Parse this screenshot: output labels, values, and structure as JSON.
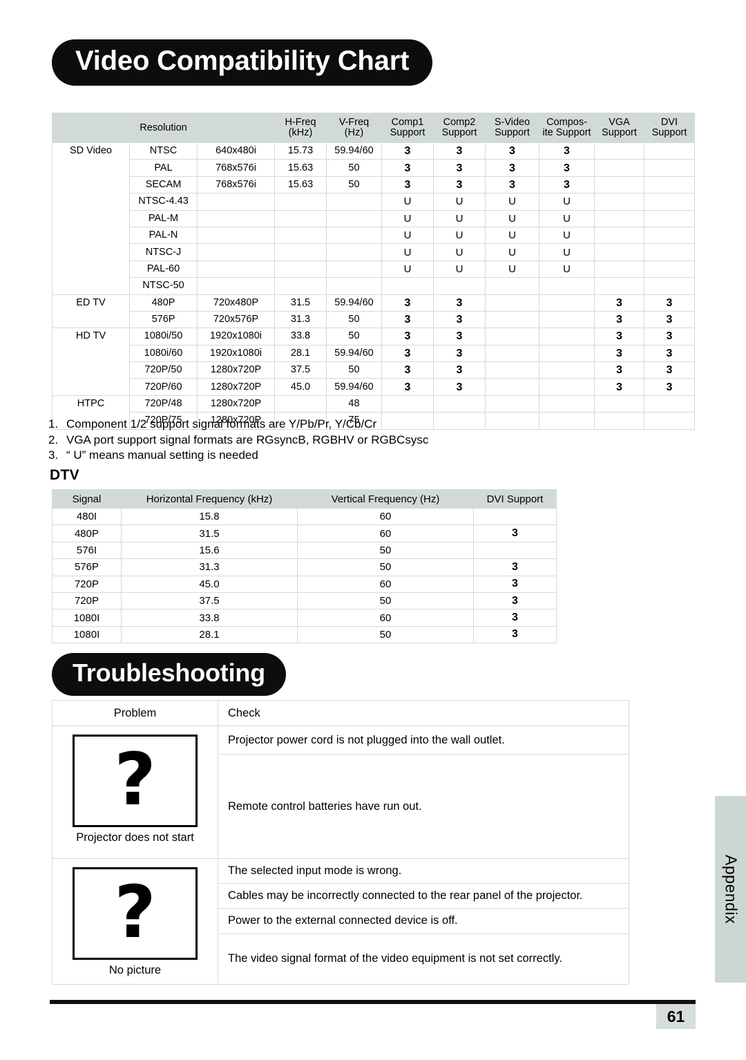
{
  "sections": {
    "video_title": "Video Compatibility Chart",
    "troubleshooting_title": "Troubleshooting",
    "dtv_heading": "DTV"
  },
  "video_chart": {
    "headers": {
      "resolution": "Resolution",
      "hfreq_l1": "H-Freq",
      "hfreq_l2": "(kHz)",
      "vfreq_l1": "V-Freq",
      "vfreq_l2": "(Hz)",
      "comp1_l1": "Comp1",
      "comp1_l2": "Support",
      "comp2_l1": "Comp2",
      "comp2_l2": "Support",
      "svideo_l1": "S-Video",
      "svideo_l2": "Support",
      "composite_l1": "Compos-",
      "composite_l2": "ite Support",
      "vga_l1": "VGA",
      "vga_l2": "Support",
      "dvi_l1": "DVI",
      "dvi_l2": "Support"
    },
    "categories": [
      {
        "name": "SD Video",
        "rows": [
          {
            "signal": "NTSC",
            "resolution": "640x480i",
            "hfreq": "15.73",
            "vfreq": "59.94/60",
            "comp1": "3",
            "comp2": "3",
            "svideo": "3",
            "composite": "3",
            "vga": "",
            "dvi": ""
          },
          {
            "signal": "PAL",
            "resolution": "768x576i",
            "hfreq": "15.63",
            "vfreq": "50",
            "comp1": "3",
            "comp2": "3",
            "svideo": "3",
            "composite": "3",
            "vga": "",
            "dvi": ""
          },
          {
            "signal": "SECAM",
            "resolution": "768x576i",
            "hfreq": "15.63",
            "vfreq": "50",
            "comp1": "3",
            "comp2": "3",
            "svideo": "3",
            "composite": "3",
            "vga": "",
            "dvi": ""
          },
          {
            "signal": "NTSC-4.43",
            "resolution": "",
            "hfreq": "",
            "vfreq": "",
            "comp1": "U",
            "comp2": "U",
            "svideo": "U",
            "composite": "U",
            "vga": "",
            "dvi": ""
          },
          {
            "signal": "PAL-M",
            "resolution": "",
            "hfreq": "",
            "vfreq": "",
            "comp1": "U",
            "comp2": "U",
            "svideo": "U",
            "composite": "U",
            "vga": "",
            "dvi": ""
          },
          {
            "signal": "PAL-N",
            "resolution": "",
            "hfreq": "",
            "vfreq": "",
            "comp1": "U",
            "comp2": "U",
            "svideo": "U",
            "composite": "U",
            "vga": "",
            "dvi": ""
          },
          {
            "signal": "NTSC-J",
            "resolution": "",
            "hfreq": "",
            "vfreq": "",
            "comp1": "U",
            "comp2": "U",
            "svideo": "U",
            "composite": "U",
            "vga": "",
            "dvi": ""
          },
          {
            "signal": "PAL-60",
            "resolution": "",
            "hfreq": "",
            "vfreq": "",
            "comp1": "U",
            "comp2": "U",
            "svideo": "U",
            "composite": "U",
            "vga": "",
            "dvi": ""
          },
          {
            "signal": "NTSC-50",
            "resolution": "",
            "hfreq": "",
            "vfreq": "",
            "comp1": "",
            "comp2": "",
            "svideo": "",
            "composite": "",
            "vga": "",
            "dvi": ""
          }
        ]
      },
      {
        "name": "ED TV",
        "rows": [
          {
            "signal": "480P",
            "resolution": "720x480P",
            "hfreq": "31.5",
            "vfreq": "59.94/60",
            "comp1": "3",
            "comp2": "3",
            "svideo": "",
            "composite": "",
            "vga": "3",
            "dvi": "3"
          },
          {
            "signal": "576P",
            "resolution": "720x576P",
            "hfreq": "31.3",
            "vfreq": "50",
            "comp1": "3",
            "comp2": "3",
            "svideo": "",
            "composite": "",
            "vga": "3",
            "dvi": "3"
          }
        ]
      },
      {
        "name": "HD TV",
        "rows": [
          {
            "signal": "1080i/50",
            "resolution": "1920x1080i",
            "hfreq": "33.8",
            "vfreq": "50",
            "comp1": "3",
            "comp2": "3",
            "svideo": "",
            "composite": "",
            "vga": "3",
            "dvi": "3"
          },
          {
            "signal": "1080i/60",
            "resolution": "1920x1080i",
            "hfreq": "28.1",
            "vfreq": "59.94/60",
            "comp1": "3",
            "comp2": "3",
            "svideo": "",
            "composite": "",
            "vga": "3",
            "dvi": "3"
          },
          {
            "signal": "720P/50",
            "resolution": "1280x720P",
            "hfreq": "37.5",
            "vfreq": "50",
            "comp1": "3",
            "comp2": "3",
            "svideo": "",
            "composite": "",
            "vga": "3",
            "dvi": "3"
          },
          {
            "signal": "720P/60",
            "resolution": "1280x720P",
            "hfreq": "45.0",
            "vfreq": "59.94/60",
            "comp1": "3",
            "comp2": "3",
            "svideo": "",
            "composite": "",
            "vga": "3",
            "dvi": "3"
          }
        ]
      },
      {
        "name": "HTPC",
        "rows": [
          {
            "signal": "720P/48",
            "resolution": "1280x720P",
            "hfreq": "",
            "vfreq": "48",
            "comp1": "",
            "comp2": "",
            "svideo": "",
            "composite": "",
            "vga": "",
            "dvi": ""
          },
          {
            "signal": "720P/75",
            "resolution": "1280x720P",
            "hfreq": "",
            "vfreq": "75",
            "comp1": "",
            "comp2": "",
            "svideo": "",
            "composite": "",
            "vga": "",
            "dvi": ""
          }
        ]
      }
    ]
  },
  "notes": [
    {
      "num": "1.",
      "text": "Component 1/2 support signal formats are Y/Pb/Pr, Y/Cb/Cr"
    },
    {
      "num": "2.",
      "text": "VGA port support signal formats are RGsyncB, RGBHV or RGBCsysc"
    },
    {
      "num": "3.",
      "text": "“ U” means manual setting is needed"
    }
  ],
  "dtv_table": {
    "headers": [
      "Signal",
      "Horizontal Frequency (kHz)",
      "Vertical Frequency (Hz)",
      "DVI Support"
    ],
    "rows": [
      {
        "signal": "480I",
        "hfreq": "15.8",
        "vfreq": "60",
        "dvi": ""
      },
      {
        "signal": "480P",
        "hfreq": "31.5",
        "vfreq": "60",
        "dvi": "3"
      },
      {
        "signal": "576I",
        "hfreq": "15.6",
        "vfreq": "50",
        "dvi": ""
      },
      {
        "signal": "576P",
        "hfreq": "31.3",
        "vfreq": "50",
        "dvi": "3"
      },
      {
        "signal": "720P",
        "hfreq": "45.0",
        "vfreq": "60",
        "dvi": "3"
      },
      {
        "signal": "720P",
        "hfreq": "37.5",
        "vfreq": "50",
        "dvi": "3"
      },
      {
        "signal": "1080I",
        "hfreq": "33.8",
        "vfreq": "60",
        "dvi": "3"
      },
      {
        "signal": "1080I",
        "hfreq": "28.1",
        "vfreq": "50",
        "dvi": "3"
      }
    ]
  },
  "troubleshooting": {
    "headers": {
      "problem": "Problem",
      "check": "Check"
    },
    "groups": [
      {
        "label": "Projector does not start",
        "icon": "question-mark-icon",
        "glyph": "?",
        "checks": [
          "Projector power cord is not plugged into the wall outlet.",
          "Remote control batteries have run out."
        ]
      },
      {
        "label": "No picture",
        "icon": "question-mark-icon",
        "glyph": "?",
        "checks": [
          "The selected input mode is wrong.",
          "Cables may be incorrectly connected to the rear panel of the projector.",
          "Power to the external connected device is off.",
          "The video signal format of the video equipment is not set correctly."
        ]
      }
    ]
  },
  "sidebar": {
    "tab_label": "Appendix"
  },
  "footer": {
    "page_number": "61"
  }
}
